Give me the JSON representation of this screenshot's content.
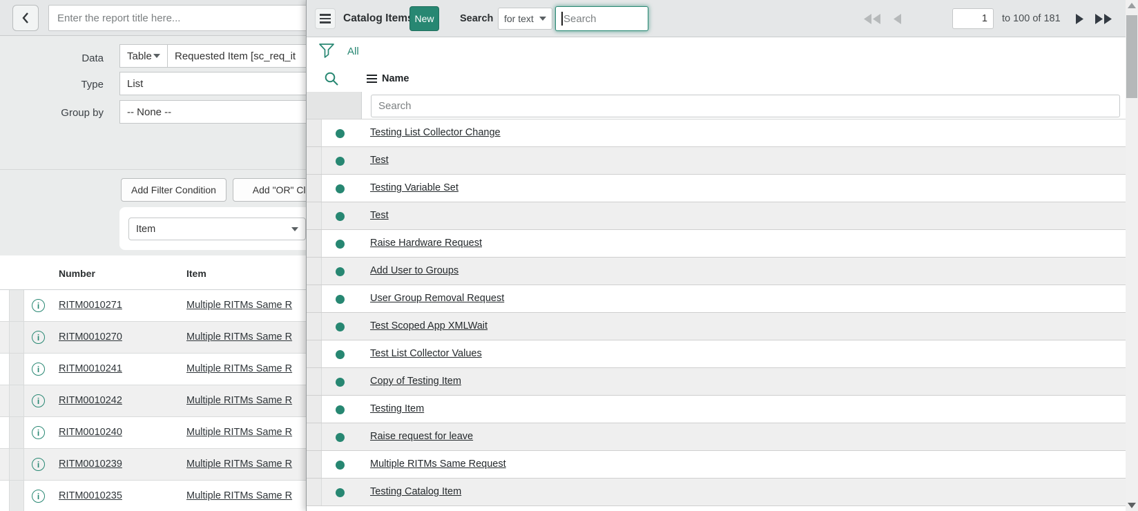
{
  "colors": {
    "accent": "#278772",
    "status_dot": "#278772"
  },
  "report_builder": {
    "title_placeholder": "Enter the report title here...",
    "fields": {
      "data_label": "Data",
      "data_source_type": "Table",
      "data_source_table": "Requested Item [sc_req_it",
      "type_label": "Type",
      "type_value": "List",
      "group_by_label": "Group by",
      "group_by_value": "-- None --"
    },
    "filters": {
      "add_filter_button": "Add Filter Condition",
      "add_or_button": "Add \"OR\" Clau",
      "condition_field": "Item"
    },
    "results_table": {
      "columns": [
        "Number",
        "Item"
      ],
      "rows": [
        {
          "number": "RITM0010271",
          "item": "Multiple RITMs Same R"
        },
        {
          "number": "RITM0010270",
          "item": "Multiple RITMs Same R"
        },
        {
          "number": "RITM0010241",
          "item": "Multiple RITMs Same R"
        },
        {
          "number": "RITM0010242",
          "item": "Multiple RITMs Same R"
        },
        {
          "number": "RITM0010240",
          "item": "Multiple RITMs Same R"
        },
        {
          "number": "RITM0010239",
          "item": "Multiple RITMs Same R"
        },
        {
          "number": "RITM0010235",
          "item": "Multiple RITMs Same R"
        }
      ]
    }
  },
  "catalog_panel": {
    "title": "Catalog Items",
    "new_button": "New",
    "search_label": "Search",
    "search_mode": "for text",
    "search_placeholder": "Search",
    "pagination": {
      "current_page": "1",
      "range_label": "to 100 of 181"
    },
    "breadcrumb_all": "All",
    "column_header": "Name",
    "column_search_placeholder": "Search",
    "items": [
      "Testing List Collector Change",
      "Test",
      "Testing Variable Set",
      "Test",
      "Raise Hardware Request",
      "Add User to Groups",
      "User Group Removal Request",
      "Test Scoped App XMLWait",
      "Test List Collector Values",
      "Copy of Testing Item",
      "Testing Item",
      "Raise request for leave",
      "Multiple RITMs Same Request",
      "Testing Catalog Item"
    ]
  }
}
